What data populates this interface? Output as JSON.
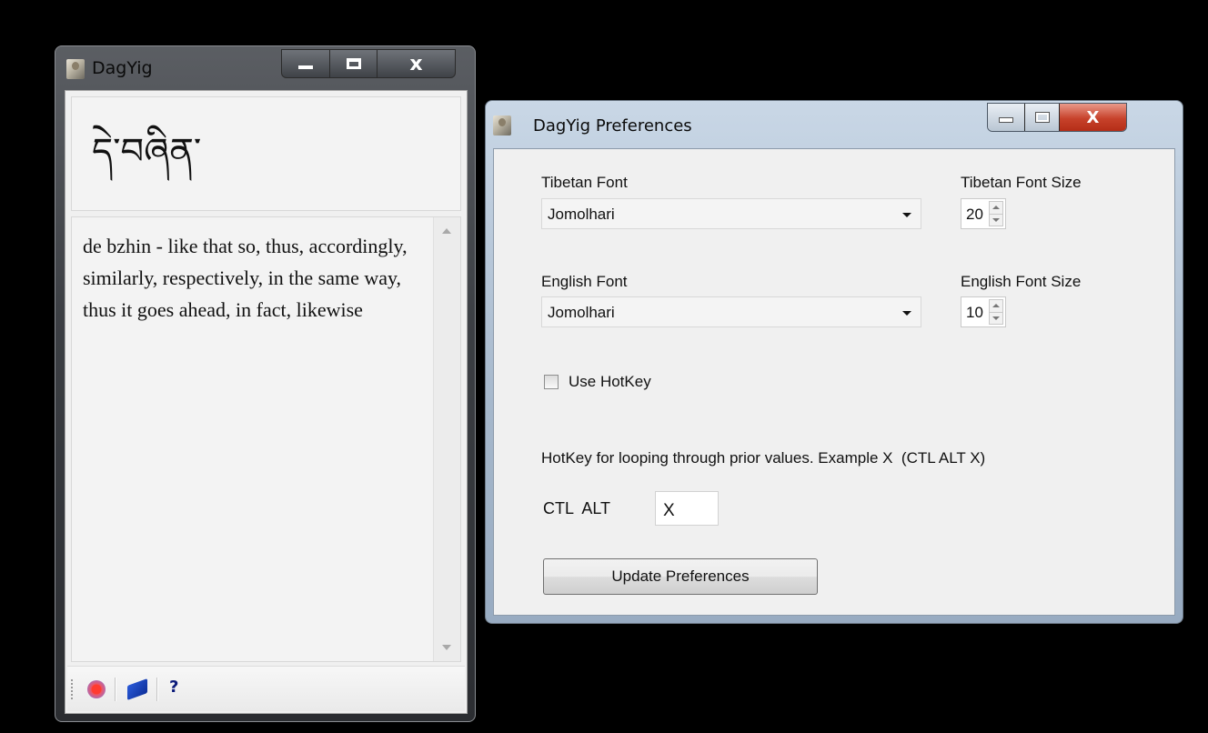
{
  "main_window": {
    "title": "DagYig",
    "tibetan_word": "དེ་བཞིན་",
    "definition": "de bzhin - like that so, thus, accordingly, similarly, respectively, in the same way, thus it goes ahead, in fact, likewise",
    "toolbar": {
      "items": [
        {
          "icon": "record-icon"
        },
        {
          "icon": "book-icon"
        },
        {
          "icon": "help-icon",
          "label": "?"
        }
      ]
    }
  },
  "preferences_window": {
    "title": "DagYig Preferences",
    "tibetan_font": {
      "label": "Tibetan Font",
      "value": "Jomolhari"
    },
    "tibetan_font_size": {
      "label": "Tibetan Font Size",
      "value": "20"
    },
    "english_font": {
      "label": "English Font",
      "value": "Jomolhari"
    },
    "english_font_size": {
      "label": "English Font Size",
      "value": "10"
    },
    "use_hotkey": {
      "label": "Use HotKey",
      "checked": false
    },
    "hotkey_hint": "HotKey for looping through prior values. Example X  (CTL ALT X)",
    "hotkey_prefix": "CTL  ALT",
    "hotkey_value": "X",
    "update_button": "Update Preferences"
  }
}
